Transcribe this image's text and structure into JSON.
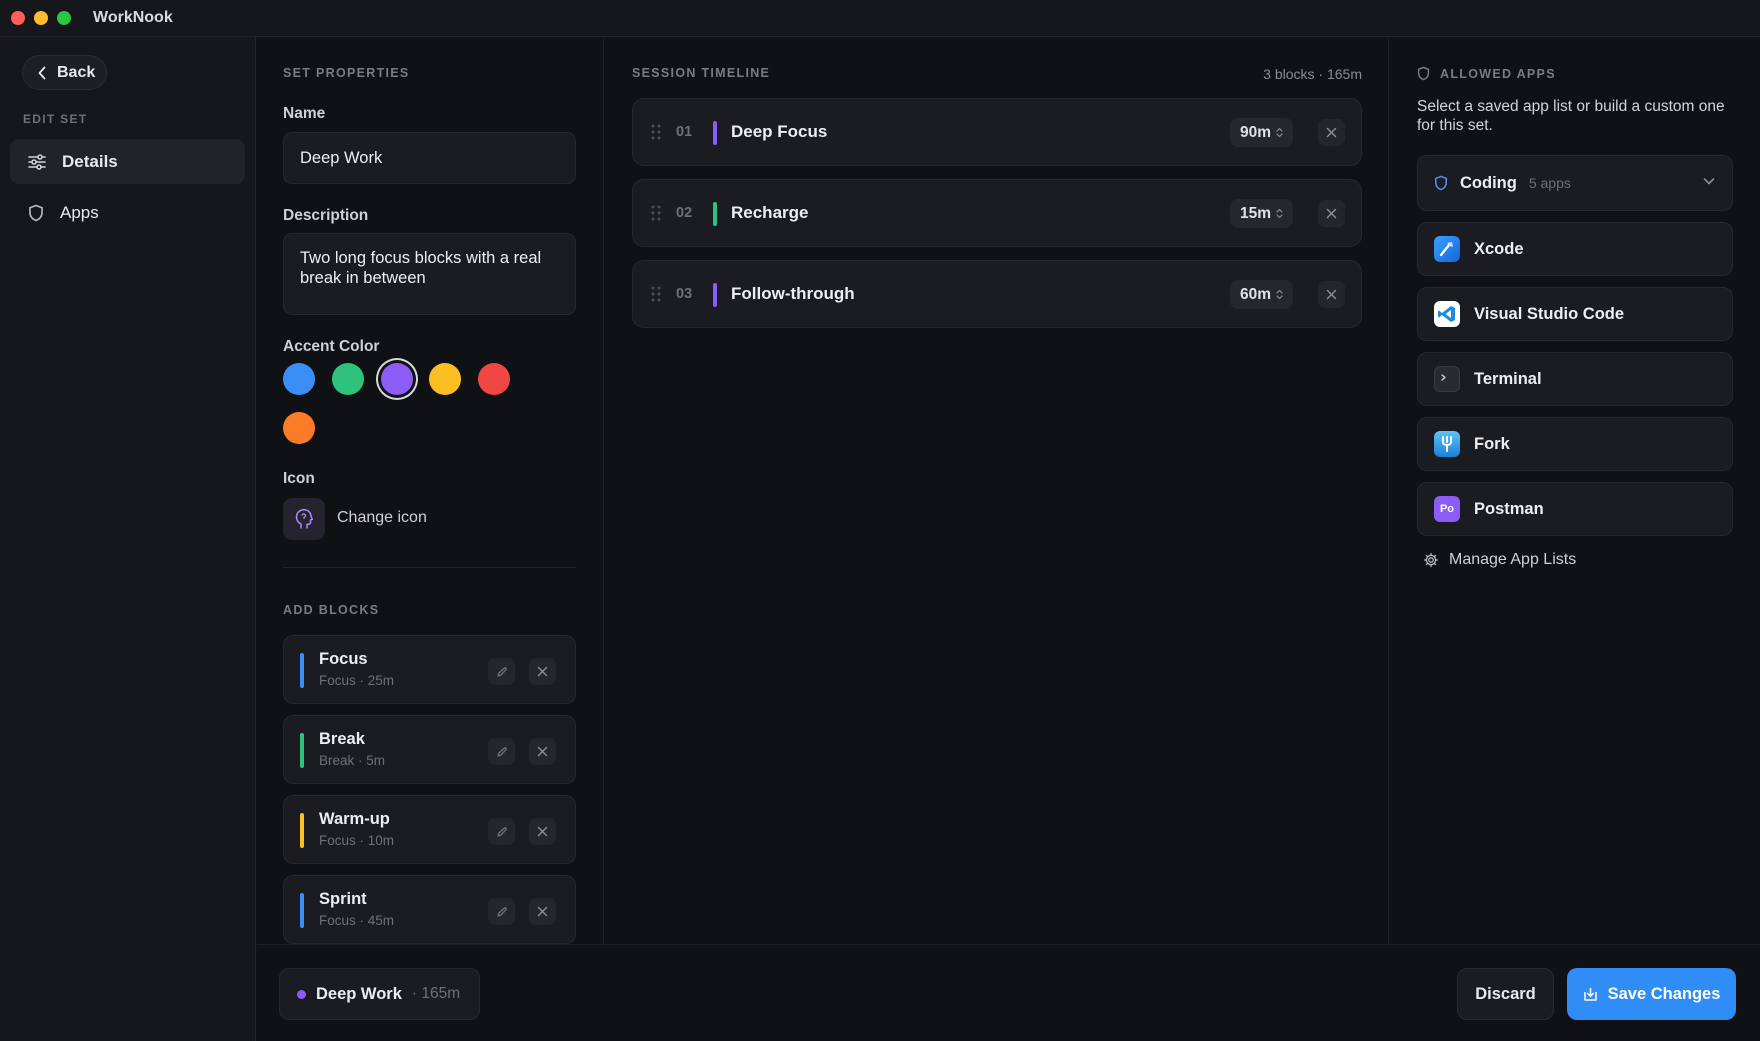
{
  "window": {
    "title": "WorkNook"
  },
  "sidebar": {
    "back_label": "Back",
    "heading": "EDIT SET",
    "items": [
      {
        "label": "Details",
        "icon": "sliders-icon",
        "active": true
      },
      {
        "label": "Apps",
        "icon": "shield-icon",
        "active": false
      }
    ]
  },
  "properties": {
    "heading": "SET PROPERTIES",
    "name_label": "Name",
    "name_value": "Deep Work",
    "description_label": "Description",
    "description_value": "Two long focus blocks with a real break in between",
    "accent_label": "Accent Color",
    "accent_colors": [
      "#3b8ef5",
      "#2ec27e",
      "#8b5cf6",
      "#fbbf24",
      "#f04646",
      "#fb7b26"
    ],
    "accent_selected": "#8b5cf6",
    "icon_label": "Icon",
    "change_icon_label": "Change icon"
  },
  "add_blocks": {
    "heading": "ADD BLOCKS",
    "items": [
      {
        "name": "Focus",
        "meta": "Focus · 25m",
        "color": "#3b8ef5"
      },
      {
        "name": "Break",
        "meta": "Break · 5m",
        "color": "#2ec27e"
      },
      {
        "name": "Warm-up",
        "meta": "Focus · 10m",
        "color": "#fbbf24"
      },
      {
        "name": "Sprint",
        "meta": "Focus · 45m",
        "color": "#3b8ef5"
      }
    ]
  },
  "timeline": {
    "heading": "SESSION TIMELINE",
    "summary": "3 blocks · 165m",
    "rows": [
      {
        "index": "01",
        "name": "Deep Focus",
        "duration": "90m",
        "color": "#8b5cf6"
      },
      {
        "index": "02",
        "name": "Recharge",
        "duration": "15m",
        "color": "#2ec27e"
      },
      {
        "index": "03",
        "name": "Follow-through",
        "duration": "60m",
        "color": "#8b5cf6"
      }
    ]
  },
  "apps": {
    "heading": "ALLOWED APPS",
    "description": "Select a saved app list or build a custom one for this set.",
    "selected_list": {
      "name": "Coding",
      "count": "5 apps"
    },
    "items": [
      {
        "name": "Xcode",
        "icon": "xcode-icon"
      },
      {
        "name": "Visual Studio Code",
        "icon": "vscode-icon"
      },
      {
        "name": "Terminal",
        "icon": "terminal-icon"
      },
      {
        "name": "Fork",
        "icon": "fork-icon"
      },
      {
        "name": "Postman",
        "icon": "postman-icon",
        "icon_text": "Po"
      }
    ],
    "manage_label": "Manage App Lists"
  },
  "footer": {
    "set_name": "Deep Work",
    "set_meta": "· 165m",
    "discard_label": "Discard",
    "save_label": "Save Changes"
  }
}
